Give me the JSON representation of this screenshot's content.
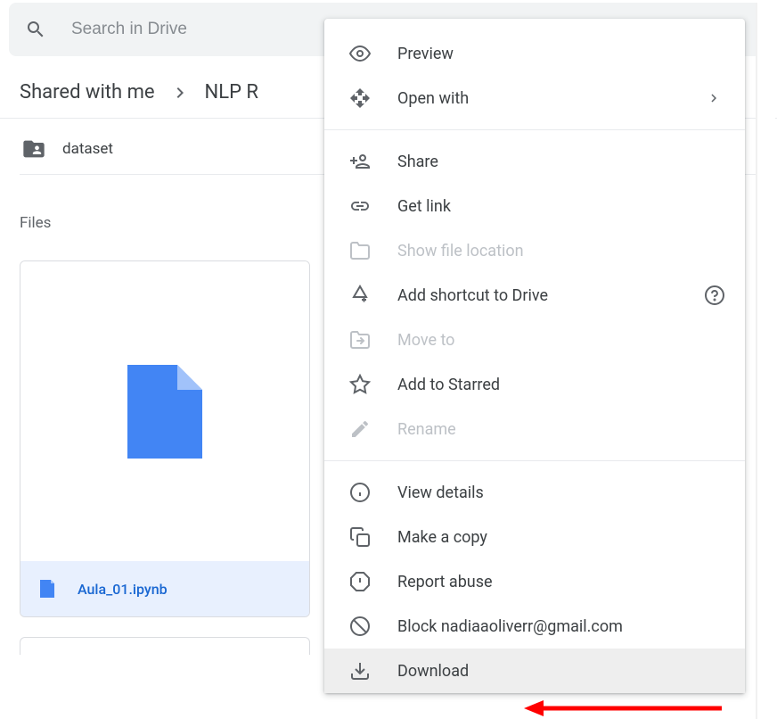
{
  "search": {
    "placeholder": "Search in Drive"
  },
  "breadcrumb": {
    "root": "Shared with me",
    "current": "NLP R"
  },
  "folder": {
    "name": "dataset"
  },
  "section": {
    "files_label": "Files"
  },
  "file": {
    "name": "Aula_01.ipynb"
  },
  "menu": {
    "preview": "Preview",
    "open_with": "Open with",
    "share": "Share",
    "get_link": "Get link",
    "show_location": "Show file location",
    "add_shortcut": "Add shortcut to Drive",
    "move_to": "Move to",
    "star": "Add to Starred",
    "rename": "Rename",
    "view_details": "View details",
    "make_copy": "Make a copy",
    "report_abuse": "Report abuse",
    "block": "Block nadiaaoliverr@gmail.com",
    "download": "Download"
  }
}
